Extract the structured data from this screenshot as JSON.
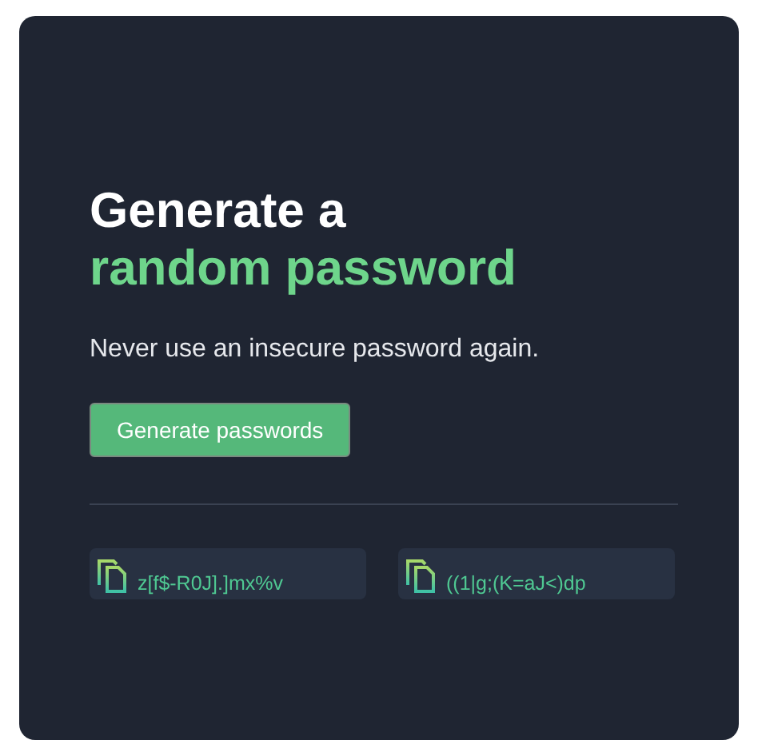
{
  "heading": {
    "line_1": "Generate a",
    "line_2": "random password"
  },
  "subtitle": "Never use an insecure password again.",
  "generate_button": "Generate passwords",
  "passwords": [
    {
      "value": "z[f$-R0J].]mx%v"
    },
    {
      "value": "((1|g;(K=aJ<)dp"
    }
  ]
}
